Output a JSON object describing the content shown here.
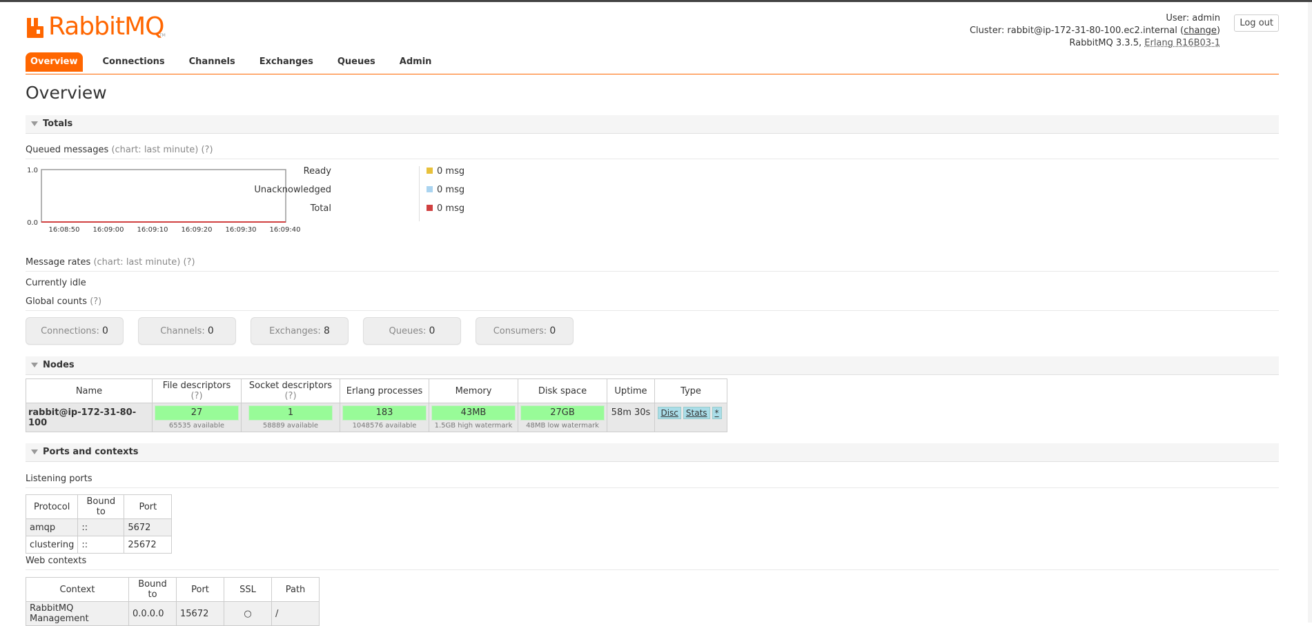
{
  "header": {
    "brand": "RabbitMQ",
    "trademark": "TM",
    "user_label": "User:",
    "user_value": "admin",
    "cluster_label": "Cluster:",
    "cluster_value": "rabbit@ip-172-31-80-100.ec2.internal",
    "change_link": "change",
    "version": "RabbitMQ 3.3.5,",
    "erlang": "Erlang R16B03-1",
    "logout": "Log out"
  },
  "tabs": [
    {
      "label": "Overview",
      "active": true
    },
    {
      "label": "Connections"
    },
    {
      "label": "Channels"
    },
    {
      "label": "Exchanges"
    },
    {
      "label": "Queues"
    },
    {
      "label": "Admin"
    }
  ],
  "page_title": "Overview",
  "sections": {
    "totals": "Totals",
    "nodes": "Nodes",
    "ports": "Ports and contexts"
  },
  "queued": {
    "label": "Queued messages",
    "note": "(chart: last minute)",
    "help": "(?)",
    "legend": [
      {
        "label": "Ready",
        "value": "0 msg",
        "color": "#e8c13b"
      },
      {
        "label": "Unacknowledged",
        "value": "0 msg",
        "color": "#aad4f0"
      },
      {
        "label": "Total",
        "value": "0 msg",
        "color": "#d04040"
      }
    ]
  },
  "chart_data": {
    "type": "line",
    "x": [
      "16:08:50",
      "16:09:00",
      "16:09:10",
      "16:09:20",
      "16:09:30",
      "16:09:40"
    ],
    "series": [
      {
        "name": "Ready",
        "values": [
          0,
          0,
          0,
          0,
          0,
          0
        ]
      },
      {
        "name": "Unacknowledged",
        "values": [
          0,
          0,
          0,
          0,
          0,
          0
        ]
      },
      {
        "name": "Total",
        "values": [
          0,
          0,
          0,
          0,
          0,
          0
        ]
      }
    ],
    "ylim": [
      0,
      1
    ],
    "yticks": [
      "1.0",
      "0.0"
    ],
    "grid": false
  },
  "rates": {
    "label": "Message rates",
    "note": "(chart: last minute)",
    "help": "(?)",
    "idle": "Currently idle"
  },
  "global": {
    "label": "Global counts",
    "help": "(?)",
    "counts": [
      {
        "label": "Connections:",
        "value": "0"
      },
      {
        "label": "Channels:",
        "value": "0"
      },
      {
        "label": "Exchanges:",
        "value": "8"
      },
      {
        "label": "Queues:",
        "value": "0"
      },
      {
        "label": "Consumers:",
        "value": "0"
      }
    ]
  },
  "nodes_table": {
    "headers": {
      "name": "Name",
      "fd": "File descriptors",
      "sd": "Socket descriptors",
      "ep": "Erlang processes",
      "mem": "Memory",
      "disk": "Disk space",
      "uptime": "Uptime",
      "type": "Type",
      "help": "(?)"
    },
    "row": {
      "name": "rabbit@ip-172-31-80-100",
      "fd": "27",
      "fd_sub": "65535 available",
      "sd": "1",
      "sd_sub": "58889 available",
      "ep": "183",
      "ep_sub": "1048576 available",
      "mem": "43MB",
      "mem_sub": "1.5GB high watermark",
      "disk": "27GB",
      "disk_sub": "48MB low watermark",
      "uptime": "58m 30s",
      "type_disc": "Disc",
      "type_stats": "Stats",
      "type_star": "*"
    }
  },
  "listening": {
    "label": "Listening ports",
    "headers": [
      "Protocol",
      "Bound to",
      "Port"
    ],
    "rows": [
      [
        "amqp",
        "::",
        "5672"
      ],
      [
        "clustering",
        "::",
        "25672"
      ]
    ]
  },
  "web": {
    "label": "Web contexts",
    "headers": [
      "Context",
      "Bound to",
      "Port",
      "SSL",
      "Path"
    ],
    "rows": [
      [
        "RabbitMQ Management",
        "0.0.0.0",
        "15672",
        "○",
        "/"
      ]
    ]
  }
}
